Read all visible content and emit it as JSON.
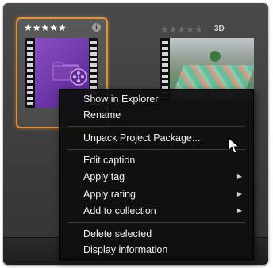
{
  "thumbnails": [
    {
      "rating_stars": "★★★★★",
      "info_icon_glyph": "i",
      "icon": "project-package-icon"
    },
    {
      "rating_stars": "★★★★★",
      "badge": "3D",
      "icon": "video-thumbnail-icon"
    }
  ],
  "context_menu": {
    "items": [
      {
        "label": "Show in Explorer"
      },
      {
        "label": "Rename"
      },
      {
        "label": "Unpack Project Package..."
      },
      {
        "label": "Edit caption"
      },
      {
        "label": "Apply tag",
        "submenu_arrow": "▶"
      },
      {
        "label": "Apply rating",
        "submenu_arrow": "▶"
      },
      {
        "label": "Add to collection",
        "submenu_arrow": "▶"
      },
      {
        "label": "Delete selected"
      },
      {
        "label": "Display information"
      }
    ]
  },
  "colors": {
    "selection_border": "#e8922e",
    "menu_background": "#0e0e0e",
    "menu_text": "#f2f2f2",
    "package_thumbnail": "#7a42b4"
  }
}
